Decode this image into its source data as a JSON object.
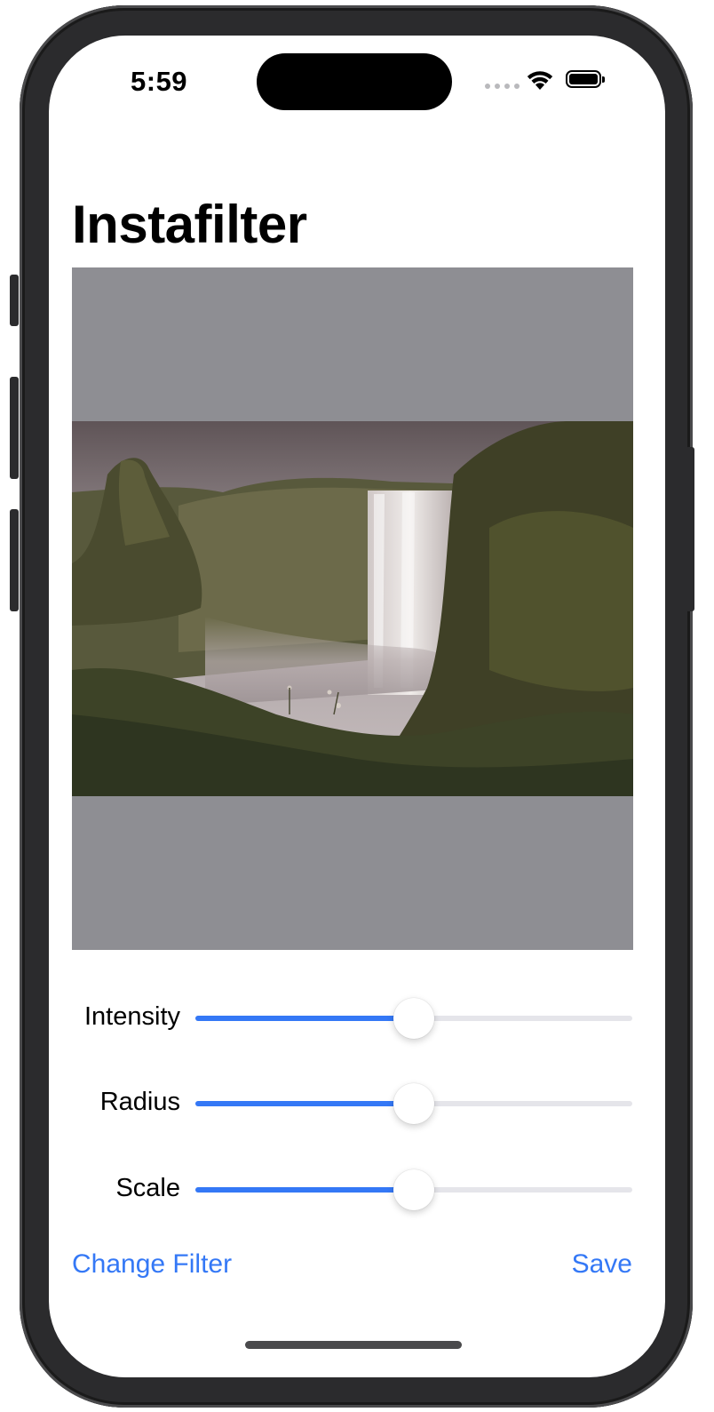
{
  "status_bar": {
    "time": "5:59"
  },
  "app": {
    "title": "Instafilter"
  },
  "image": {
    "description_icon": "waterfall-photo"
  },
  "sliders": [
    {
      "label": "Intensity",
      "value": 0.5
    },
    {
      "label": "Radius",
      "value": 0.5
    },
    {
      "label": "Scale",
      "value": 0.5
    }
  ],
  "toolbar": {
    "change_filter_label": "Change Filter",
    "save_label": "Save"
  },
  "colors": {
    "accent": "#3478f6",
    "image_background": "#8e8e93",
    "track": "#e5e5ea"
  }
}
